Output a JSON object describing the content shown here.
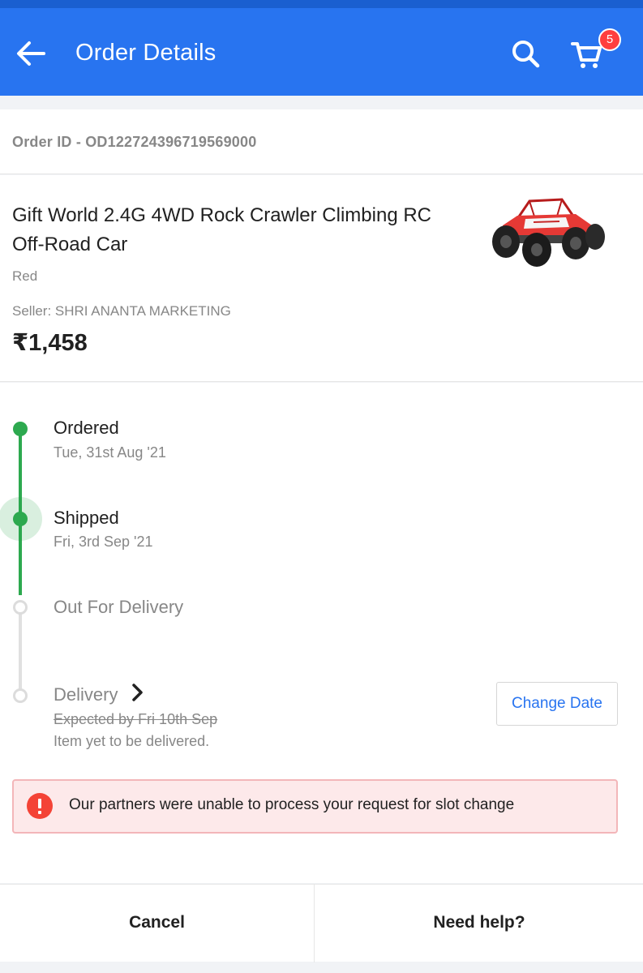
{
  "header": {
    "title": "Order Details",
    "cart_count": "5",
    "icons": [
      "back-arrow-icon",
      "search-icon",
      "cart-icon"
    ]
  },
  "order": {
    "id_text": "Order ID - OD122724396719569000"
  },
  "product": {
    "name": "Gift World 2.4G 4WD Rock Crawler Climbing RC Off-Road Car",
    "color": "Red",
    "seller": "Seller: SHRI ANANTA MARKETING",
    "price": "₹1,458"
  },
  "tracking": {
    "steps": [
      {
        "title": "Ordered",
        "date": "Tue, 31st Aug '21",
        "status": "done"
      },
      {
        "title": "Shipped",
        "date": "Fri, 3rd Sep '21",
        "status": "current"
      },
      {
        "title": "Out For Delivery",
        "date": "",
        "status": "pending"
      },
      {
        "title": "Delivery",
        "expected": "Expected by Fri 10th Sep",
        "note": "Item yet to be delivered.",
        "status": "pending"
      }
    ],
    "change_date_label": "Change Date"
  },
  "alert": {
    "text": "Our partners were unable to process your request for slot change"
  },
  "footer": {
    "cancel_label": "Cancel",
    "help_label": "Need help?"
  },
  "colors": {
    "primary": "#2874f0",
    "success": "#2da94f",
    "error": "#f44336",
    "alert_bg": "#fde9ea"
  }
}
